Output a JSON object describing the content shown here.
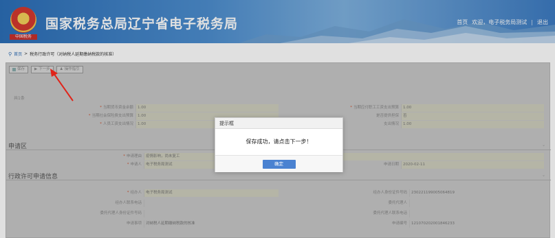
{
  "header": {
    "title": "国家税务总局辽宁省电子税务局",
    "emblem_tag": "中国税务",
    "links": [
      "首页",
      "欢迎，电子税务局测试",
      "退出"
    ],
    "brand_color": "#2c6fb8"
  },
  "breadcrumb": {
    "home": "首页",
    "separator": ">",
    "current": "税务行政许可（对纳税人延期缴纳税款的核准）"
  },
  "toolbar": {
    "buttons": [
      {
        "label": "保存",
        "icon": "save-icon"
      },
      {
        "label": "下一步",
        "icon": "next-icon"
      },
      {
        "label": "操作指引",
        "icon": "guide-icon"
      }
    ]
  },
  "count_label": "共1条",
  "top_rows": [
    {
      "left_label": "当期货币资金余额",
      "left_value": "1.00",
      "right_label": "当期应付职工工资支出预算",
      "right_value": "1.00"
    },
    {
      "left_label": "当期社会保险费支出预算",
      "left_value": "1.00",
      "right_label": "是否提供担保",
      "right_value": "否"
    },
    {
      "left_label": "人员工资支出情况",
      "left_value": "1.00",
      "right_label": "支出情况",
      "right_value": "1.00"
    }
  ],
  "section_apply": {
    "title": "申请区",
    "rows": [
      {
        "label": "申请理由",
        "value": "疫情影响，尚未复工"
      },
      {
        "label": "申请人",
        "value": "电子税务局测试",
        "right_label": "申请日期",
        "right_value": "2020-02-11"
      }
    ]
  },
  "section_permit": {
    "title": "行政许可申请信息",
    "rows": [
      {
        "left_label": "经办人",
        "left_value": "电子税务局测试",
        "right_label": "经办人身份证件号码",
        "right_value": "230221199005064819"
      },
      {
        "left_label": "经办人联系电话",
        "left_value": "",
        "right_label": "委托代理人",
        "right_value": ""
      },
      {
        "left_label": "委托代理人身份证件号码",
        "left_value": "",
        "right_label": "委托代理人联系电话",
        "right_value": ""
      },
      {
        "left_label": "申请事项",
        "left_value": "对纳税人延期缴纳税款的核准",
        "right_label": "申请编号",
        "right_value": "121070202001846233"
      }
    ]
  },
  "dialog": {
    "title": "提示框",
    "message": "保存成功，请点击下一步！",
    "ok_label": "确定",
    "button_color": "#4a82d1"
  }
}
